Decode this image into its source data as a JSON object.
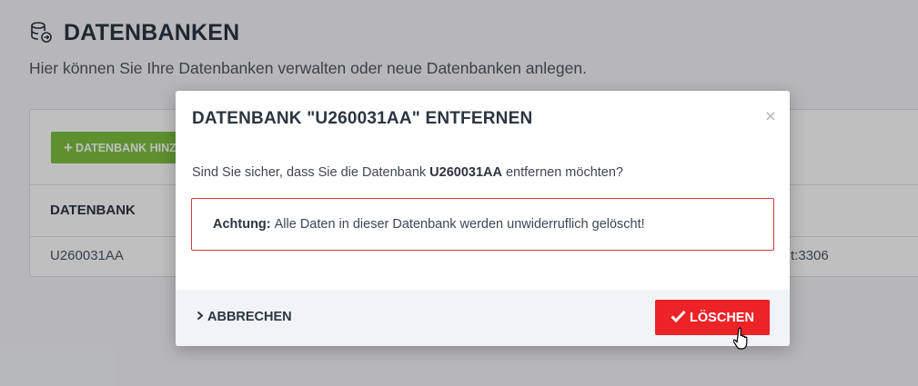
{
  "page": {
    "title": "DATENBANKEN",
    "subtitle": "Hier können Sie Ihre Datenbanken verwalten oder neue Datenbanken anlegen.",
    "icon": "database-arrow-icon"
  },
  "panel": {
    "add_button_label": "DATENBANK HINZ",
    "add_button_icon": "plus-icon",
    "column_header": "DATENBANK",
    "row": {
      "name": "U260031AA",
      "host_fragment": "t:3306"
    }
  },
  "modal": {
    "title": "DATENBANK \"U260031AA\" ENTFERNEN",
    "close_symbol": "×",
    "question_prefix": "Sind Sie sicher, dass Sie die Datenbank ",
    "question_db": "U260031AA",
    "question_suffix": " entfernen möchten?",
    "warning_label": "Achtung:",
    "warning_text": "Alle Daten in dieser Datenbank werden unwiderruflich gelöscht!",
    "cancel_label": "ABBRECHEN",
    "cancel_icon": "chevron-right-icon",
    "delete_label": "LÖSCHEN",
    "delete_icon": "check-icon"
  },
  "colors": {
    "accent_green": "#7cc241",
    "danger_red": "#ec2327",
    "warning_border": "#d83a3a"
  }
}
